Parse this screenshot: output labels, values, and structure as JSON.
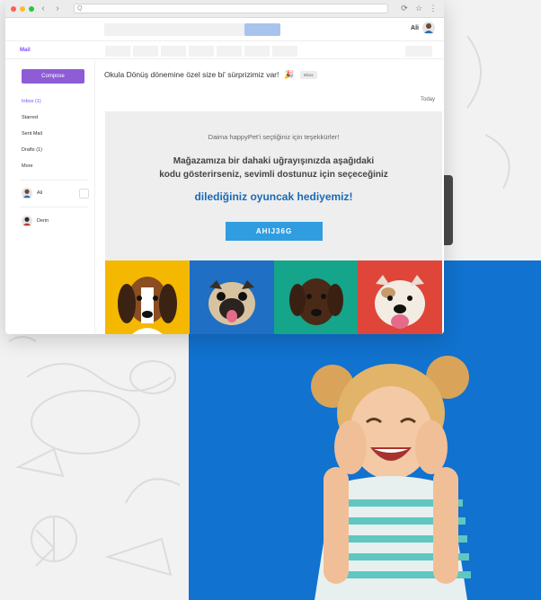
{
  "window": {
    "app_label": "Mail",
    "url_text": "Q",
    "user_name": "Ali"
  },
  "sidebar": {
    "compose_label": "Compose",
    "items": [
      {
        "label": "Inbox (1)",
        "active": true
      },
      {
        "label": "Starred",
        "active": false
      },
      {
        "label": "Sent Mail",
        "active": false
      },
      {
        "label": "Drafts (1)",
        "active": false
      },
      {
        "label": "More",
        "active": false
      }
    ],
    "contacts": [
      {
        "name": "Ali"
      },
      {
        "name": "Derin"
      }
    ]
  },
  "mail": {
    "subject": "Okula Dönüş dönemine özel size bi' sürprizimiz var!",
    "tag": "Inbox",
    "date": "Today",
    "thanks": "Daima happyPet'i seçtiğiniz için teşekkürler!",
    "pitch_line1": "Mağazamıza bir dahaki uğrayışınızda aşağıdaki",
    "pitch_line2": "kodu gösterirseniz, sevimli dostunuz için seçeceğiniz",
    "highlight": "dilediğiniz oyuncak hediyemiz!",
    "coupon_code": "AHIJ36G"
  },
  "colors": {
    "accent_purple": "#8e5cd6",
    "coupon_blue": "#2f9de0",
    "highlight_blue": "#1a6ab7",
    "panel_blue": "#1172cf",
    "dog_panels": [
      "#f5b800",
      "#1f6fc4",
      "#14a58a",
      "#e0453a"
    ]
  }
}
